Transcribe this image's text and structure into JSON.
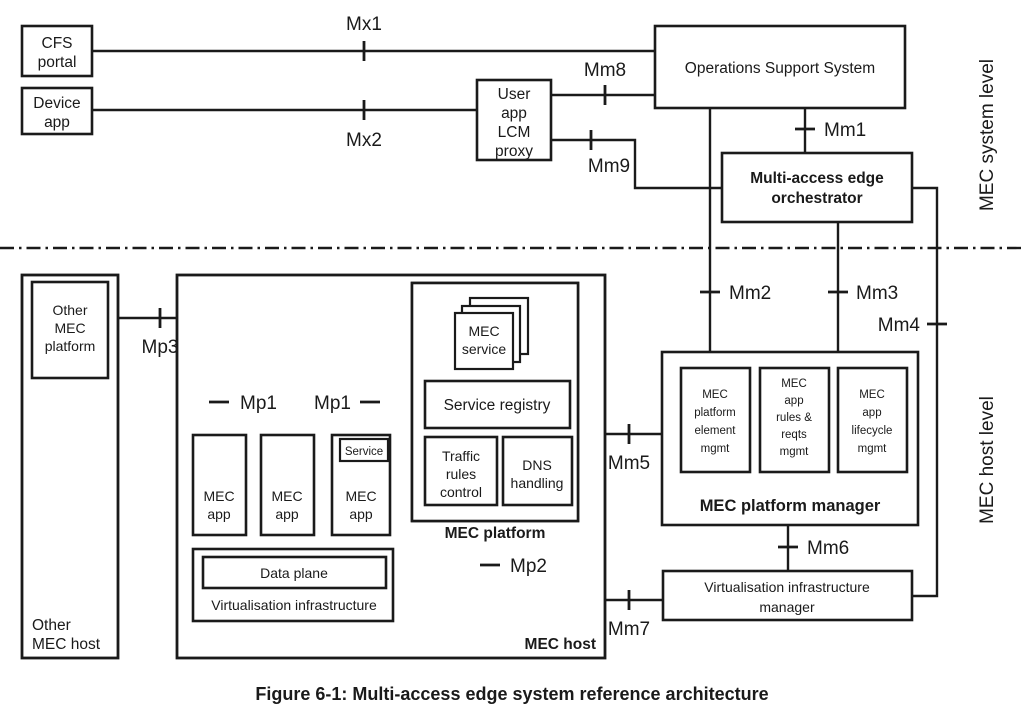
{
  "figure": {
    "caption": "Figure 6-1: Multi-access edge system reference architecture",
    "levels": {
      "system": "MEC system level",
      "host": "MEC host level"
    }
  },
  "boxes": {
    "cfs_portal": "CFS\nportal",
    "cfs_portal_l1": "CFS",
    "cfs_portal_l2": "portal",
    "device_app_l1": "Device",
    "device_app_l2": "app",
    "user_app_lcm_proxy_l1": "User",
    "user_app_lcm_proxy_l2": "app",
    "user_app_lcm_proxy_l3": "LCM",
    "user_app_lcm_proxy_l4": "proxy",
    "oss": "Operations Support  System",
    "orchestrator_l1": "Multi-access edge",
    "orchestrator_l2": "orchestrator",
    "other_mec_platform_l1": "Other",
    "other_mec_platform_l2": "MEC",
    "other_mec_platform_l3": "platform",
    "other_mec_host_l1": "Other",
    "other_mec_host_l2": "MEC host",
    "mec_service_l1": "MEC",
    "mec_service_l2": "service",
    "service_registry": "Service registry",
    "traffic_rules_control_l1": "Traffic",
    "traffic_rules_control_l2": "rules",
    "traffic_rules_control_l3": "control",
    "dns_handling_l1": "DNS",
    "dns_handling_l2": "handling",
    "mec_platform": "MEC platform",
    "mec_app_l1": "MEC",
    "mec_app_l2": "app",
    "service_badge": "Service",
    "data_plane": "Data plane",
    "virtualisation_infrastructure": "Virtualisation infrastructure",
    "mec_host": "MEC host",
    "mec_platform_element_mgmt_l1": "MEC",
    "mec_platform_element_mgmt_l2": "platform",
    "mec_platform_element_mgmt_l3": "element",
    "mec_platform_element_mgmt_l4": "mgmt",
    "mec_app_rules_reqts_mgmt_l1": "MEC",
    "mec_app_rules_reqts_mgmt_l2": "app",
    "mec_app_rules_reqts_mgmt_l3": "rules &",
    "mec_app_rules_reqts_mgmt_l4": "reqts",
    "mec_app_rules_reqts_mgmt_l5": "mgmt",
    "mec_app_lifecycle_mgmt_l1": "MEC",
    "mec_app_lifecycle_mgmt_l2": "app",
    "mec_app_lifecycle_mgmt_l3": "lifecycle",
    "mec_app_lifecycle_mgmt_l4": "mgmt",
    "mec_platform_manager": "MEC platform manager",
    "vim_l1": "Virtualisation infrastructure",
    "vim_l2": "manager"
  },
  "reference_points": {
    "mx1": "Mx1",
    "mx2": "Mx2",
    "mm8": "Mm8",
    "mm9": "Mm9",
    "mm1": "Mm1",
    "mm2": "Mm2",
    "mm3": "Mm3",
    "mm4": "Mm4",
    "mm5": "Mm5",
    "mm6": "Mm6",
    "mm7": "Mm7",
    "mp1_a": "Mp1",
    "mp1_b": "Mp1",
    "mp2": "Mp2",
    "mp3": "Mp3"
  },
  "colors": {
    "line": "#1a1a1a",
    "fill": "#ffffff",
    "background": "#ffffff"
  }
}
